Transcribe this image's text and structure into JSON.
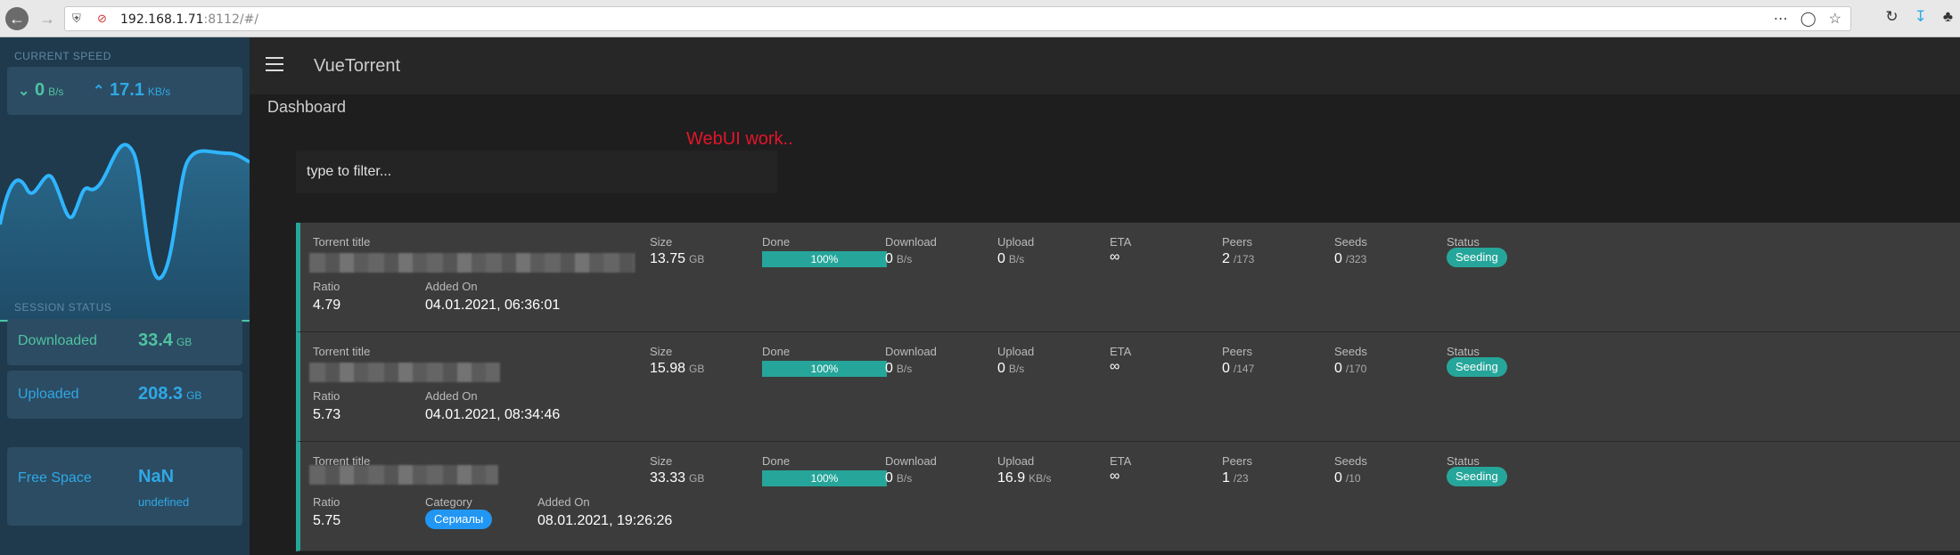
{
  "browser": {
    "url_host": "192.168.1.71",
    "url_rest": ":8112/#/"
  },
  "sidebar": {
    "current_speed_heading": "CURRENT SPEED",
    "download_speed": {
      "value": "0",
      "unit": "B/s"
    },
    "upload_speed": {
      "value": "17.1",
      "unit": "KB/s"
    },
    "session_status_heading": "SESSION STATUS",
    "downloaded": {
      "label": "Downloaded",
      "value": "33.4",
      "unit": "GB"
    },
    "uploaded": {
      "label": "Uploaded",
      "value": "208.3",
      "unit": "GB"
    },
    "free_space": {
      "label": "Free Space",
      "value": "NaN",
      "sub": "undefined"
    }
  },
  "header": {
    "app_title": "VueTorrent"
  },
  "page": {
    "title": "Dashboard",
    "note": "WebUI work..",
    "filter_placeholder": "type to filter..."
  },
  "columns": {
    "title": "Torrent title",
    "size": "Size",
    "done": "Done",
    "download": "Download",
    "upload": "Upload",
    "eta": "ETA",
    "peers": "Peers",
    "seeds": "Seeds",
    "status": "Status",
    "ratio": "Ratio",
    "added_on": "Added On",
    "category": "Category"
  },
  "torrents": [
    {
      "size": "13.75",
      "size_unit": "GB",
      "done": "100%",
      "download": "0",
      "download_unit": "B/s",
      "upload": "0",
      "upload_unit": "B/s",
      "eta": "∞",
      "peers": "2",
      "peers_total": "/173",
      "seeds": "0",
      "seeds_total": "/323",
      "status": "Seeding",
      "ratio": "4.79",
      "added_on": "04.01.2021, 06:36:01",
      "category": ""
    },
    {
      "size": "15.98",
      "size_unit": "GB",
      "done": "100%",
      "download": "0",
      "download_unit": "B/s",
      "upload": "0",
      "upload_unit": "B/s",
      "eta": "∞",
      "peers": "0",
      "peers_total": "/147",
      "seeds": "0",
      "seeds_total": "/170",
      "status": "Seeding",
      "ratio": "5.73",
      "added_on": "04.01.2021, 08:34:46",
      "category": ""
    },
    {
      "size": "33.33",
      "size_unit": "GB",
      "done": "100%",
      "download": "0",
      "download_unit": "B/s",
      "upload": "16.9",
      "upload_unit": "KB/s",
      "eta": "∞",
      "peers": "1",
      "peers_total": "/23",
      "seeds": "0",
      "seeds_total": "/10",
      "status": "Seeding",
      "ratio": "5.75",
      "added_on": "08.01.2021, 19:26:26",
      "category": "Сериалы"
    }
  ],
  "colors": {
    "accent": "#26a69a",
    "download": "#4fc3a1",
    "upload": "#2fa8e6",
    "note": "#e3152a"
  },
  "icons": [
    "back-arrow-icon",
    "forward-arrow-icon",
    "shield-icon",
    "insecure-lock-icon",
    "more-icon",
    "pocket-icon",
    "star-icon",
    "reload-icon",
    "download-icon",
    "extension-icon",
    "menu-icon",
    "chevron-down-icon",
    "chevron-up-icon"
  ]
}
